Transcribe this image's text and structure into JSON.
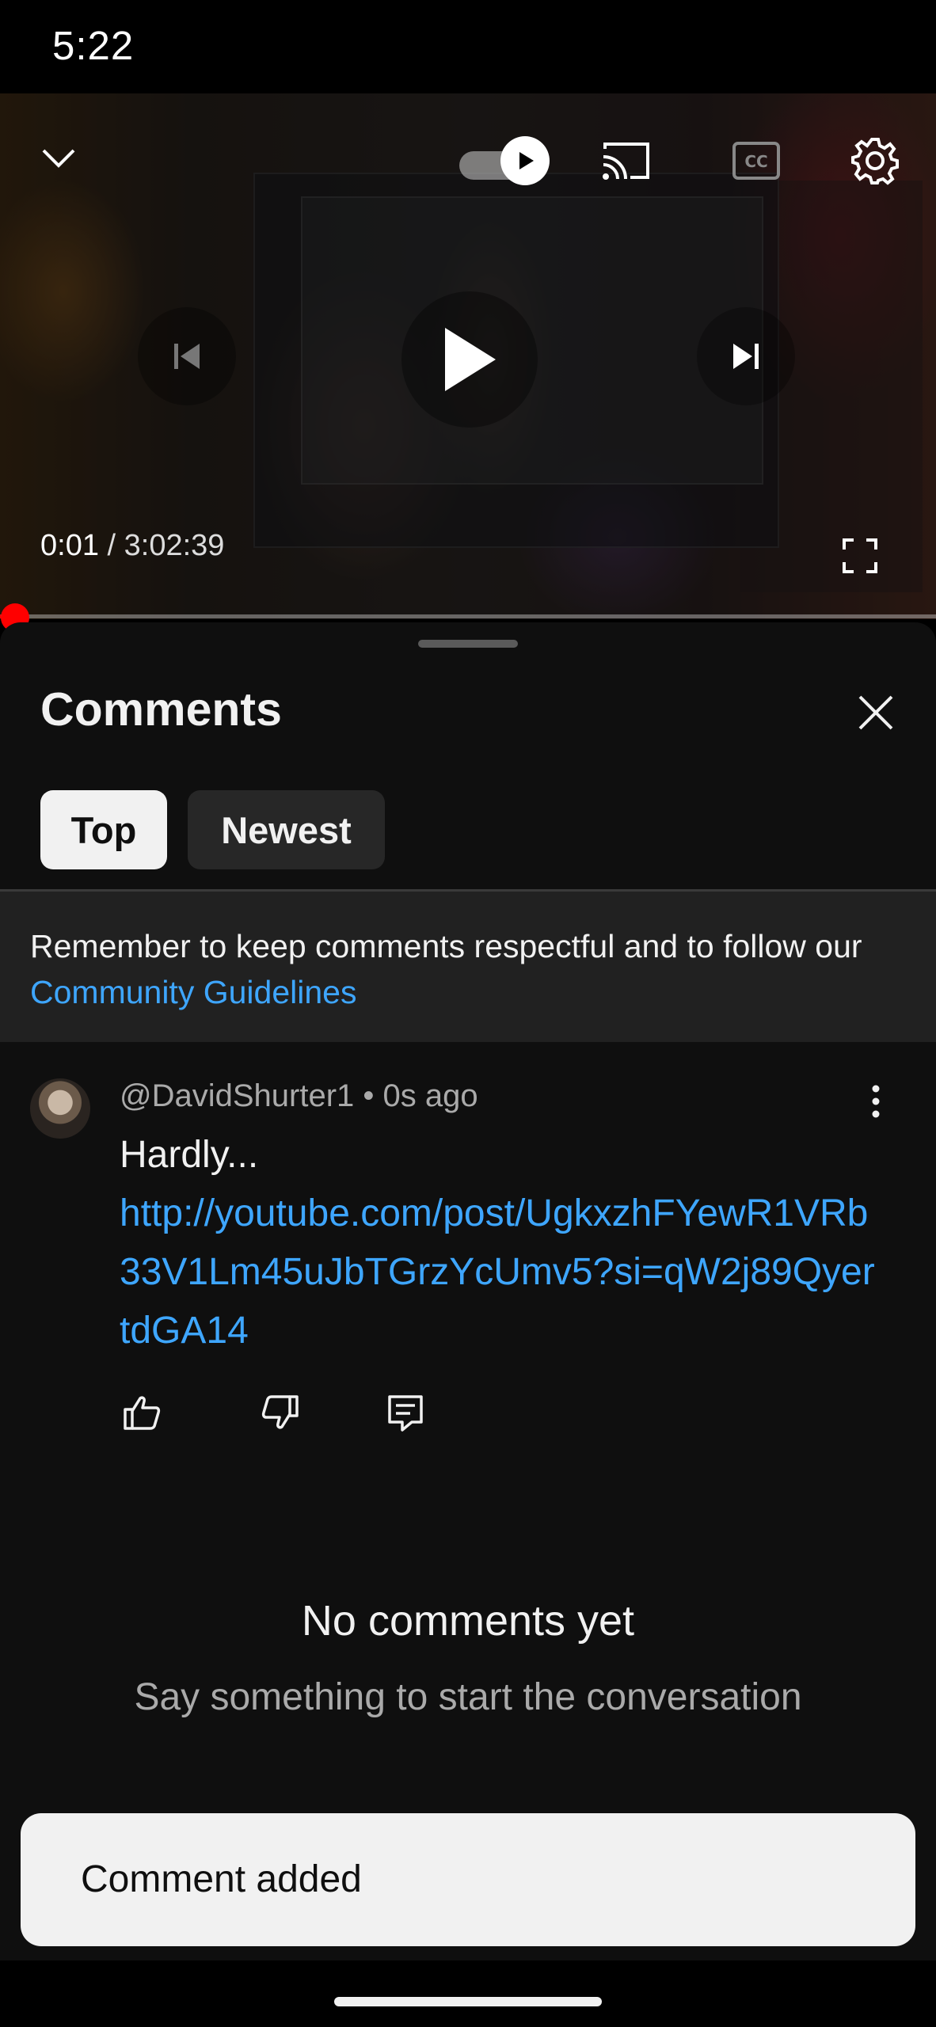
{
  "status_bar": {
    "time": "5:22"
  },
  "player": {
    "current_time": "0:01",
    "separator": " / ",
    "total_time": "3:02:39",
    "progress_fraction": 0.0001,
    "autoplay_on": true
  },
  "comments_sheet": {
    "title": "Comments",
    "tabs": [
      {
        "label": "Top",
        "selected": true
      },
      {
        "label": "Newest",
        "selected": false
      }
    ],
    "guidelines_text": "Remember to keep comments respectful and to follow our ",
    "guidelines_link": "Community Guidelines",
    "comment": {
      "author": "@DavidShurter1",
      "separator": " • ",
      "time": "0s ago",
      "text": "Hardly...",
      "link": "http://youtube.com/post/UgkxzhFYewR1VRb33V1Lm45uJbTGrzYcUmv5?si=qW2j89QyertdGA14"
    },
    "empty_title": "No comments yet",
    "empty_subtitle": "Say something to start the conversation"
  },
  "snackbar": {
    "text": "Comment added"
  },
  "colors": {
    "background": "#0f0f0f",
    "link": "#3ea6ff",
    "progress": "#ff0000",
    "chip_selected": "#f1f1f1",
    "chip_unselected": "#272727"
  },
  "icons": [
    "chevron-down-icon",
    "autoplay-toggle-icon",
    "cast-icon",
    "captions-icon",
    "settings-icon",
    "previous-icon",
    "play-icon",
    "next-icon",
    "fullscreen-icon",
    "close-icon",
    "more-vert-icon",
    "thumbs-up-icon",
    "thumbs-down-icon",
    "reply-icon"
  ]
}
